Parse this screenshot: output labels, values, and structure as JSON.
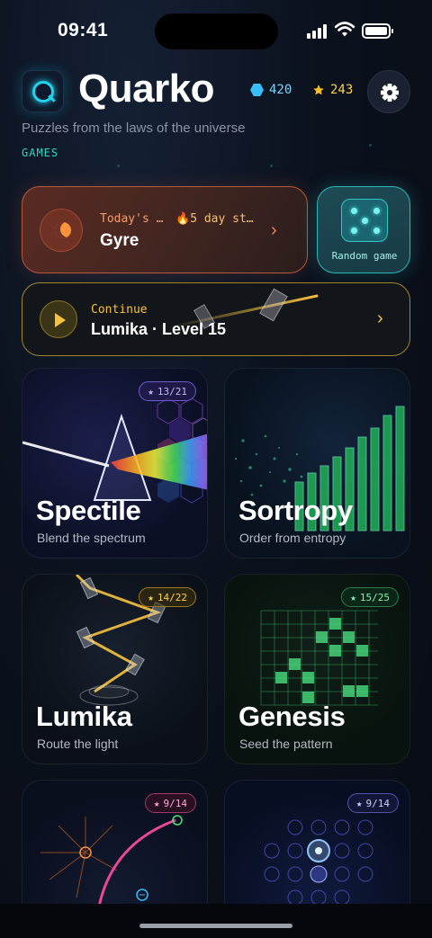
{
  "status_bar": {
    "time": "09:41"
  },
  "header": {
    "app_name": "Quarko",
    "logo_letter": "Q",
    "gems": "420",
    "stars": "243",
    "tagline": "Puzzles from the laws of the universe",
    "section_label": "GAMES"
  },
  "icons": {
    "gems": "hexagon-gem-icon",
    "stars": "star-icon",
    "settings": "gear-icon",
    "today": "moon-icon",
    "streak": "flame-icon",
    "random": "dice-icon",
    "continue": "play-icon"
  },
  "today_card": {
    "label": "Today's …",
    "streak": "5 day st…",
    "game": "Gyre"
  },
  "random_card": {
    "label": "Random game"
  },
  "continue_card": {
    "label": "Continue",
    "game": "Lumika · Level 15"
  },
  "games": [
    {
      "title": "Spectile",
      "subtitle": "Blend the spectrum",
      "progress": "13/21",
      "accent": "#a78bfa"
    },
    {
      "title": "Sortropy",
      "subtitle": "Order from entropy",
      "progress": "",
      "accent": "#34d399"
    },
    {
      "title": "Lumika",
      "subtitle": "Route the light",
      "progress": "14/22",
      "accent": "#fbbf24"
    },
    {
      "title": "Genesis",
      "subtitle": "Seed the pattern",
      "progress": "15/25",
      "accent": "#4ade80"
    },
    {
      "title": "",
      "subtitle": "",
      "progress": "9/14",
      "accent": "#f472b6"
    },
    {
      "title": "",
      "subtitle": "",
      "progress": "9/14",
      "accent": "#a5b4fc"
    }
  ],
  "colors": {
    "today_accent": "#f97c52",
    "random_accent": "#2fb6b6",
    "continue_accent": "#f6c23e",
    "section_accent": "#2dd4bf"
  }
}
